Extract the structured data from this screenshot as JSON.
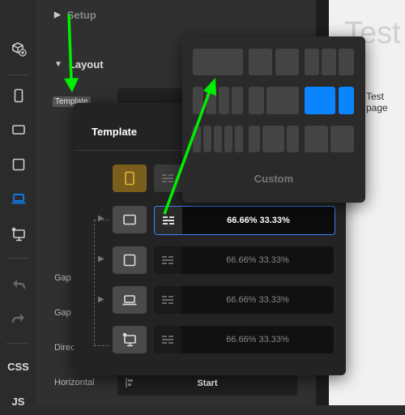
{
  "sidebar": {
    "items": [
      {
        "name": "add-block-icon"
      },
      {
        "name": "mobile-portrait-icon"
      },
      {
        "name": "mobile-landscape-icon"
      },
      {
        "name": "tablet-icon"
      },
      {
        "name": "laptop-icon",
        "active": true
      },
      {
        "name": "desktop-icon"
      },
      {
        "name": "undo-icon"
      },
      {
        "name": "redo-icon"
      }
    ],
    "css_label": "CSS",
    "js_label": "JS",
    "accent": "#0a84ff"
  },
  "panel": {
    "setup_label": "Setup",
    "layout_label": "Layout",
    "template_label": "Template",
    "gap1_label": "Gap",
    "gap2_label": "Gap",
    "direction_label": "Direc",
    "horizontal_label": "Horizontal",
    "start_label": "Start"
  },
  "canvas": {
    "title": "Test",
    "body_text": "Test page"
  },
  "popup": {
    "title": "Template",
    "rows": [
      {
        "device": "mobile-portrait-icon",
        "value": "",
        "selected": false
      },
      {
        "device": "tablet-icon",
        "value": "66.66% 33.33%",
        "selected": true
      },
      {
        "device": "tablet-icon",
        "value": "66.66% 33.33%",
        "selected": false
      },
      {
        "device": "laptop-icon",
        "value": "66.66% 33.33%",
        "selected": false
      },
      {
        "device": "desktop-icon",
        "value": "66.66% 33.33%",
        "selected": false
      }
    ]
  },
  "layout_picker": {
    "custom_label": "Custom",
    "highlight_color": "#0a84ff"
  },
  "annotation_color": "#00ee00"
}
